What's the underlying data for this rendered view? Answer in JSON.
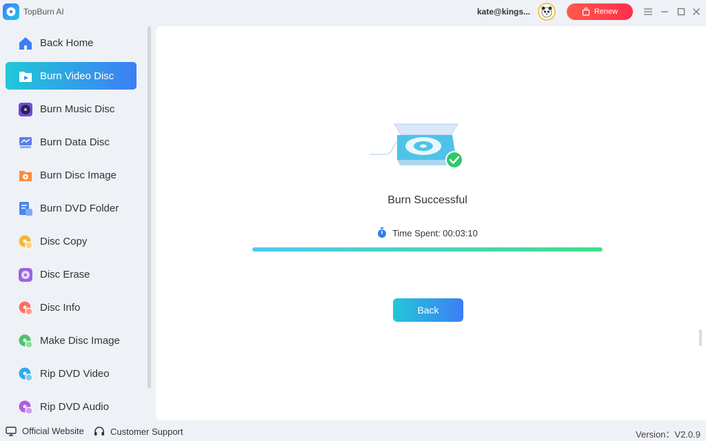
{
  "app": {
    "title": "TopBurn AI"
  },
  "header": {
    "user_email": "kate@kings...",
    "renew_label": "Renew"
  },
  "sidebar": {
    "items": [
      {
        "label": "Back Home",
        "icon": "home-icon",
        "color": "#3d7ef5"
      },
      {
        "label": "Burn Video Disc",
        "icon": "video-disc-icon",
        "color": "#ffffff"
      },
      {
        "label": "Burn Music Disc",
        "icon": "music-disc-icon",
        "color": "#6f4fd8"
      },
      {
        "label": "Burn Data Disc",
        "icon": "data-disc-icon",
        "color": "#5b7fe8"
      },
      {
        "label": "Burn Disc Image",
        "icon": "disc-image-icon",
        "color": "#ff8a3d"
      },
      {
        "label": "Burn DVD Folder",
        "icon": "dvd-folder-icon",
        "color": "#4a86f0"
      },
      {
        "label": "Disc Copy",
        "icon": "disc-copy-icon",
        "color": "#f5b638"
      },
      {
        "label": "Disc Erase",
        "icon": "disc-erase-icon",
        "color": "#9b63e0"
      },
      {
        "label": "Disc Info",
        "icon": "disc-info-icon",
        "color": "#ff6f5a"
      },
      {
        "label": "Make Disc Image",
        "icon": "make-disc-image-icon",
        "color": "#4cc26b"
      },
      {
        "label": "Rip DVD Video",
        "icon": "rip-dvd-video-icon",
        "color": "#2fa8f0"
      },
      {
        "label": "Rip DVD Audio",
        "icon": "rip-dvd-audio-icon",
        "color": "#b45be6"
      }
    ],
    "active_index": 1
  },
  "main": {
    "status_title": "Burn Successful",
    "time_label": "Time Spent: 00:03:10",
    "progress_fraction": 1.0,
    "back_label": "Back"
  },
  "footer": {
    "website_label": "Official Website",
    "support_label": "Customer Support",
    "version_label": "Version：V2.0.9"
  },
  "colors": {
    "accent_start": "#22c7d8",
    "accent_end": "#3d7ef5",
    "renew": "#ff3b4a",
    "success": "#2ec96a"
  }
}
